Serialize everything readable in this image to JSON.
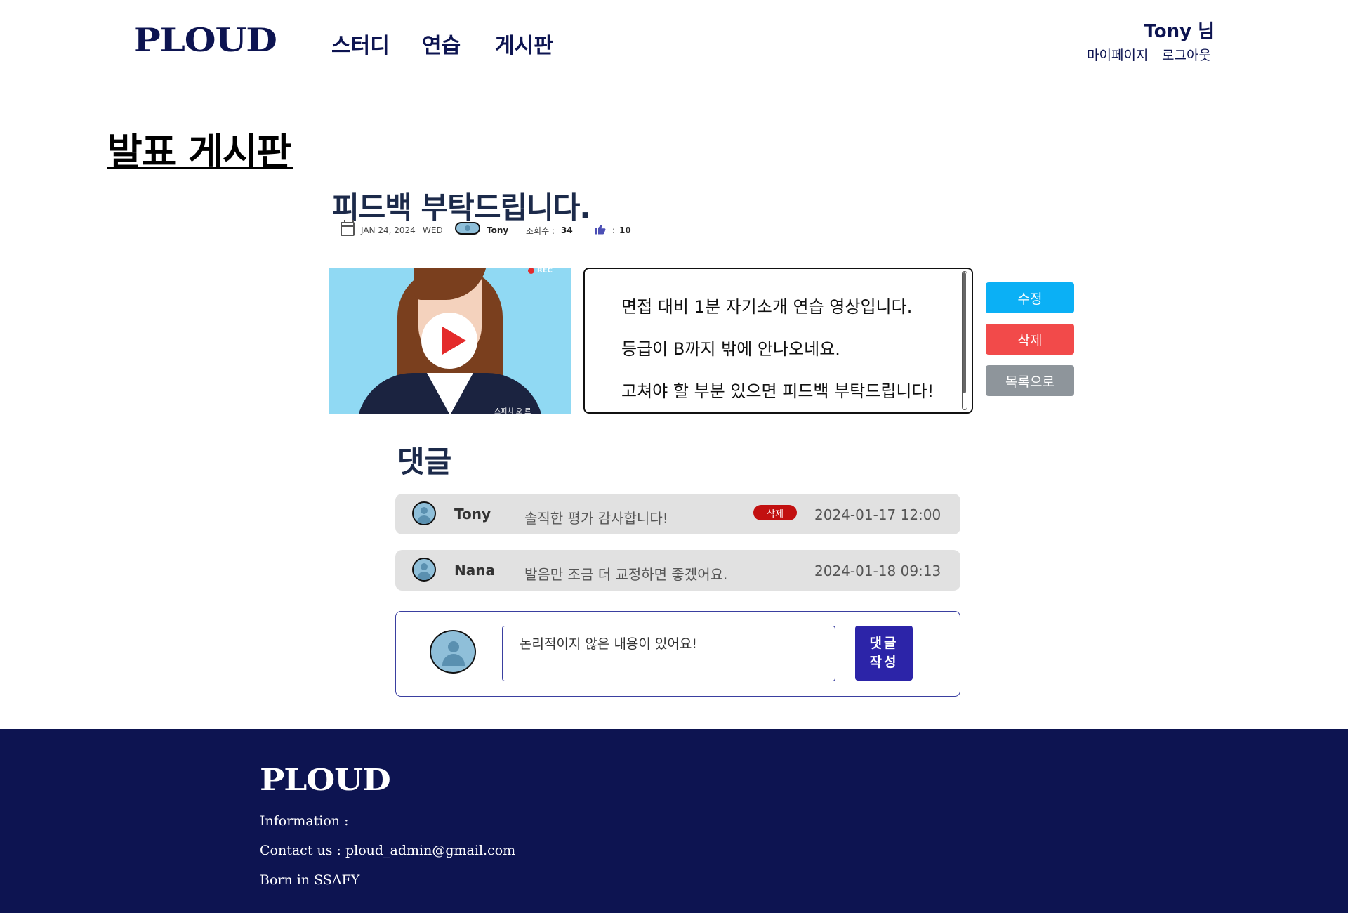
{
  "header": {
    "logo": "PLOUD",
    "nav": [
      "스터디",
      "연습",
      "게시판"
    ],
    "user_greeting": "Tony 님",
    "mypage_label": "마이페이지",
    "logout_label": "로그아웃"
  },
  "page": {
    "title": "발표 게시판"
  },
  "post": {
    "title": "피드백 부탁드립니다.",
    "date": "JAN 24, 2024",
    "weekday": "WED",
    "author": "Tony",
    "views_label": "조회수 :",
    "views": "34",
    "likes_label": ":",
    "likes": "10",
    "content": [
      "면접 대비 1분 자기소개 연습 영상입니다.",
      "등급이 B까지 밖에 안나오네요.",
      "고쳐야 할 부분 있으면 피드백 부탁드립니다!"
    ],
    "video": {
      "rec_label": "REC",
      "caption": "스피치 오 르 "
    },
    "buttons": {
      "edit": "수정",
      "delete": "삭제",
      "list": "목록으로"
    }
  },
  "comments": {
    "title": "댓글",
    "items": [
      {
        "author": "Tony",
        "text": "솔직한 평가 감사합니다!",
        "date": "2024-01-17 12:00",
        "delete_label": "삭제"
      },
      {
        "author": "Nana",
        "text": "발음만 조금 더 교정하면 좋겠어요.",
        "date": "2024-01-18 09:13"
      }
    ],
    "form": {
      "input_value": "논리적이지 않은 내용이 있어요!",
      "submit_line1": "댓글",
      "submit_line2": "작성"
    }
  },
  "footer": {
    "logo": "PLOUD",
    "information": "Information :",
    "contact": "Contact us :  ploud_admin@gmail.com",
    "born": "Born in SSAFY"
  },
  "colors": {
    "brand_navy": "#0d1451",
    "edit_button": "#0bb0f5",
    "delete_button": "#f24a4a",
    "list_button": "#8e959b",
    "comment_delete": "#c21010",
    "submit_button": "#2c24a8"
  },
  "icons": [
    "calendar-icon",
    "user-avatar-icon",
    "thumbs-up-icon",
    "play-icon"
  ]
}
